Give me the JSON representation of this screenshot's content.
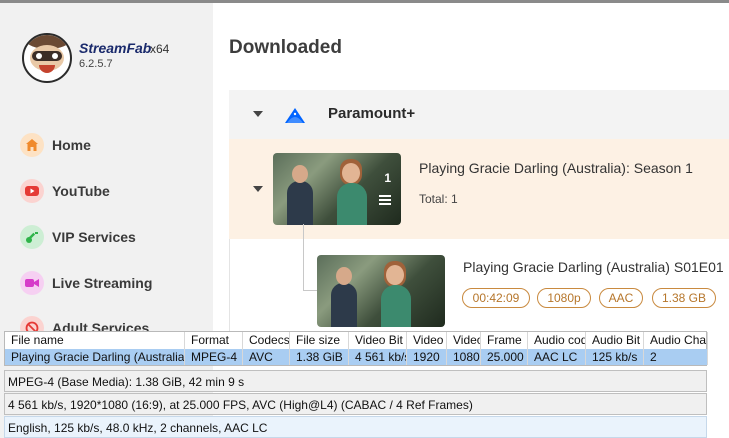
{
  "app": {
    "name": "StreamFab",
    "suffix": "x64",
    "version": "6.2.5.7"
  },
  "sidebar": {
    "items": [
      {
        "label": "Home",
        "icon": "home-icon",
        "color": "#f08a2c",
        "bg": "#fde2c4"
      },
      {
        "label": "YouTube",
        "icon": "youtube-icon",
        "color": "#e53935",
        "bg": "#fbd3d0"
      },
      {
        "label": "VIP Services",
        "icon": "key-icon",
        "color": "#2fb34a",
        "bg": "#cdeed4"
      },
      {
        "label": "Live Streaming",
        "icon": "video-camera-icon",
        "color": "#d63cc9",
        "bg": "#f6d0f2"
      },
      {
        "label": "Adult Services",
        "icon": "adult-restricted-icon",
        "color": "#e53935",
        "bg": "#fbd3d0"
      }
    ]
  },
  "main": {
    "title": "Downloaded",
    "service": {
      "name": "Paramount+",
      "logo_color": "#0064ff"
    },
    "season": {
      "title": "Playing Gracie Darling (Australia): Season 1",
      "count": "1",
      "total": "Total: 1"
    },
    "episode": {
      "title": "Playing Gracie Darling (Australia) S01E01",
      "tags": [
        "00:42:09",
        "1080p",
        "AAC",
        "1.38 GB"
      ]
    }
  },
  "mediainfo": {
    "columns": [
      "File name",
      "Format",
      "Codecs",
      "File size",
      "Video Bit",
      "Video",
      "Video",
      "Frame",
      "Audio cod",
      "Audio Bit",
      "Audio Cha"
    ],
    "row": [
      "Playing Gracie Darling (Australia",
      "MPEG-4",
      "AVC",
      "1.38 GiB",
      "4 561 kb/s",
      "1920",
      "1080",
      "25.000",
      "AAC LC",
      "125 kb/s",
      "2"
    ],
    "general": "MPEG-4 (Base Media): 1.38 GiB, 42 min 9 s",
    "video": "4 561 kb/s, 1920*1080 (16:9), at 25.000 FPS, AVC (High@L4) (CABAC / 4 Ref Frames)",
    "audio": "English, 125 kb/s, 48.0 kHz, 2 channels, AAC LC"
  }
}
